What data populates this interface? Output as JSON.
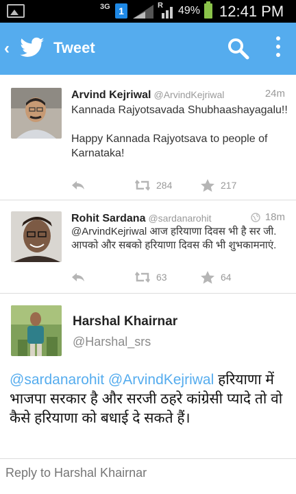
{
  "statusbar": {
    "network": "3G",
    "sim": "1",
    "roaming": "R",
    "battery": "49%",
    "time": "12:41 PM"
  },
  "actionbar": {
    "title": "Tweet",
    "back_icon": "back-chevron-icon",
    "logo_icon": "twitter-bird-icon",
    "search_icon": "search-icon",
    "more_icon": "overflow-menu-icon",
    "color": "#55acee"
  },
  "tweets": [
    {
      "name": "Arvind Kejriwal",
      "handle": "@ArvindKejriwal",
      "time": "24m",
      "text": "Kannada Rajyotsavada Shubhaashayagalu!!\n\nHappy Kannada Rajyotsava to people of Karnataka!",
      "retweets": "284",
      "favorites": "217"
    },
    {
      "name": "Rohit Sardana",
      "handle": "@sardanarohit",
      "time": "18m",
      "text": "@ArvindKejriwal आज हरियाणा दिवस भी है सर जी. आपको और सबको हरियाणा दिवस की भी शुभकामनाएं.",
      "retweets": "63",
      "favorites": "64"
    }
  ],
  "detail": {
    "name": "Harshal Khairnar",
    "handle": "@Harshal_srs",
    "mention1": "@sardanarohit",
    "mention2": "@ArvindKejriwal",
    "text": "हरियाणा में भाजपा सरकार है और सरजी ठहरे कांग्रेसी प्यादे तो वो कैसे हरियाणा को बधाई दे सकते हैं।"
  },
  "reply": {
    "placeholder": "Reply to Harshal Khairnar"
  }
}
